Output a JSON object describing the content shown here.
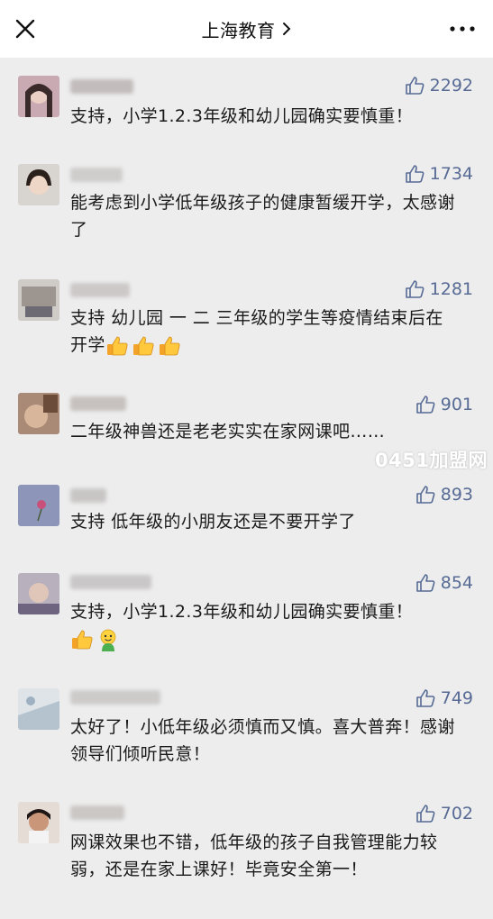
{
  "header": {
    "title": "上海教育",
    "close_icon": "close-icon",
    "more_icon": "more-dots-icon",
    "chevron_icon": "chevron-right-icon"
  },
  "colors": {
    "like": "#576b95",
    "background": "#ededed",
    "header": "#ffffff"
  },
  "comments": [
    {
      "likes": "2292",
      "text": "支持，小学1.2.3年级和幼儿园确实要慎重！",
      "emojis": []
    },
    {
      "likes": "1734",
      "text": "能考虑到小学低年级孩子的健康暂缓开学，太感谢了",
      "emojis": []
    },
    {
      "likes": "1281",
      "text": "支持 幼儿园 一 二 三年级的学生等疫情结束后在开学",
      "emojis": [
        "thumbs-up-emoji",
        "thumbs-up-emoji",
        "thumbs-up-emoji"
      ]
    },
    {
      "likes": "901",
      "text": "二年级神兽还是老老实实在家网课吧……",
      "emojis": []
    },
    {
      "likes": "893",
      "text": "支持 低年级的小朋友还是不要开学了",
      "emojis": []
    },
    {
      "likes": "854",
      "text": "支持，小学1.2.3年级和幼儿园确实要慎重！",
      "emojis": [
        "thumbs-up-emoji",
        "face-emoji"
      ]
    },
    {
      "likes": "749",
      "text": "太好了！小低年级必须慎而又慎。喜大普奔！感谢领导们倾听民意！",
      "emojis": []
    },
    {
      "likes": "702",
      "text": "网课效果也不错，低年级的孩子自我管理能力较弱，还是在家上课好！毕竟安全第一！",
      "emojis": []
    }
  ],
  "watermark": "0451加盟网"
}
